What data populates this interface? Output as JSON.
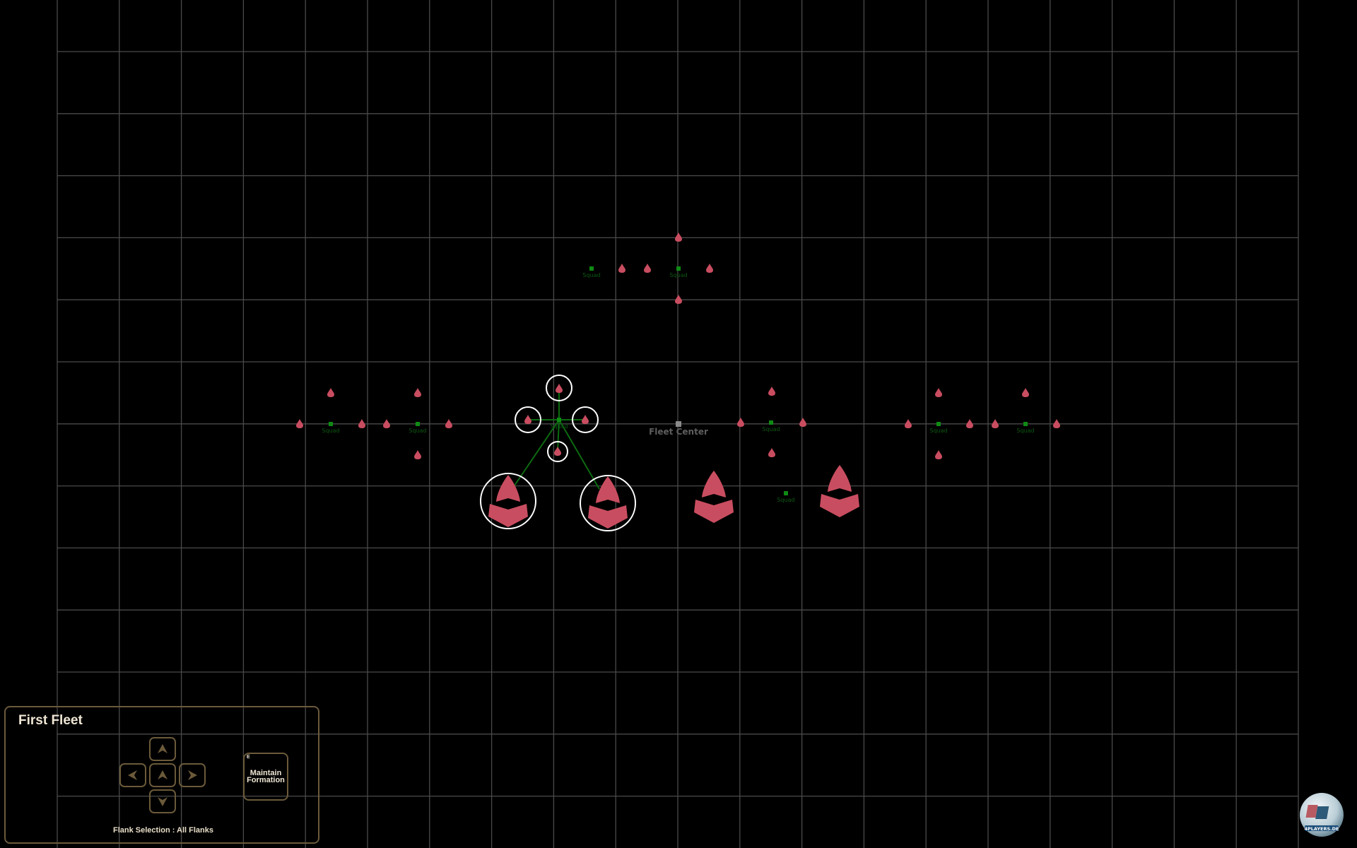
{
  "colors": {
    "background": "#000000",
    "grid": "#4a4a4a",
    "ship": "#c94d60",
    "squad_marker": "#0f8a14",
    "squad_label": "#0d5a12",
    "selection_ring": "#ffffff",
    "link_line": "#0c6a10",
    "fleet_center": "#8a8a8a",
    "panel_border": "#6b5a3a",
    "panel_text": "#efe6d4"
  },
  "map": {
    "fleet_center_label": "Fleet Center",
    "squad_label": "Squad",
    "squads": [
      {
        "id": "top-left",
        "selected": false
      },
      {
        "id": "top-center",
        "selected": false
      },
      {
        "id": "left-1",
        "selected": false
      },
      {
        "id": "left-2",
        "selected": false
      },
      {
        "id": "center-selected",
        "selected": true
      },
      {
        "id": "right-1",
        "selected": false
      },
      {
        "id": "right-lower",
        "selected": false
      },
      {
        "id": "far-right-1",
        "selected": false
      },
      {
        "id": "far-right-2",
        "selected": false
      }
    ],
    "small_ships_count": 28,
    "large_ships_count": 4,
    "selected_ships_count": 6
  },
  "panel": {
    "title": "First Fleet",
    "buttons": {
      "up": "arrow-up",
      "left": "arrow-left",
      "center": "arrow-up",
      "right": "arrow-right",
      "down": "arrow-down"
    },
    "maintain_formation": {
      "hotkey": "E",
      "label": "Maintain\nFormation"
    },
    "flank_selection": "Flank Selection : All Flanks"
  },
  "watermark": "4PLAYERS.DE"
}
